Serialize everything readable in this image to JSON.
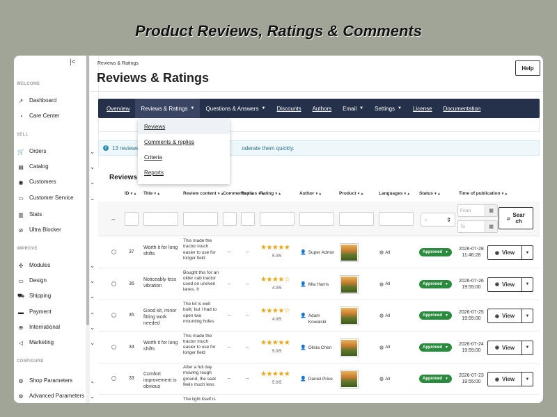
{
  "banner": "Product Reviews, Ratings & Comments",
  "sidebar": {
    "collapse_icon": "collapse-icon",
    "sections": {
      "welcome": "WELCOME",
      "sell": "SELL",
      "improve": "IMPROVE",
      "configure": "CONFIGURE"
    },
    "items": [
      {
        "label": "Dashboard",
        "icon": "trend-icon",
        "chevron": false
      },
      {
        "label": "Care Center",
        "icon": "care-icon",
        "chevron": false
      },
      {
        "label": "Orders",
        "icon": "basket-icon",
        "chevron": true
      },
      {
        "label": "Catalog",
        "icon": "catalog-icon",
        "chevron": true
      },
      {
        "label": "Customers",
        "icon": "customer-icon",
        "chevron": true
      },
      {
        "label": "Customer Service",
        "icon": "chat-icon",
        "chevron": true
      },
      {
        "label": "Stats",
        "icon": "stats-icon",
        "chevron": false
      },
      {
        "label": "Ultra Blocker",
        "icon": "blocker-icon",
        "chevron": false
      },
      {
        "label": "Modules",
        "icon": "puzzle-icon",
        "chevron": true
      },
      {
        "label": "Design",
        "icon": "monitor-icon",
        "chevron": true
      },
      {
        "label": "Shipping",
        "icon": "truck-icon",
        "chevron": true
      },
      {
        "label": "Payment",
        "icon": "card-icon",
        "chevron": true
      },
      {
        "label": "International",
        "icon": "globe-icon",
        "chevron": true
      },
      {
        "label": "Marketing",
        "icon": "megaphone-icon",
        "chevron": true
      },
      {
        "label": "Shop Parameters",
        "icon": "gear-icon",
        "chevron": true
      },
      {
        "label": "Advanced Parameters",
        "icon": "advanced-icon",
        "chevron": true
      }
    ]
  },
  "header": {
    "breadcrumb": "Reviews & Ratings",
    "title": "Reviews & Ratings",
    "help_label": "Help"
  },
  "nav": {
    "items": [
      {
        "label": "Overview",
        "dropdown": false
      },
      {
        "label": "Reviews & Ratings",
        "dropdown": true
      },
      {
        "label": "Questions & Answers",
        "dropdown": true
      },
      {
        "label": "Discounts",
        "dropdown": false
      },
      {
        "label": "Authors",
        "dropdown": false
      },
      {
        "label": "Email",
        "dropdown": true
      },
      {
        "label": "Settings",
        "dropdown": true
      },
      {
        "label": "License",
        "dropdown": false
      },
      {
        "label": "Documentation",
        "dropdown": false
      }
    ],
    "dropdown_items": [
      "Reviews",
      "Comments & replies",
      "Criteria",
      "Reports"
    ]
  },
  "info": {
    "text": "13 reviews",
    "text_tail": "oderate them quickly."
  },
  "panel": {
    "title": "Reviews",
    "columns": [
      "ID",
      "Title",
      "Review content",
      "Comments",
      "Replies",
      "Rating",
      "Author",
      "Product",
      "Languages",
      "Status",
      "Time of publication"
    ],
    "filters": {
      "dash": "--",
      "status_value": "-",
      "date_from_placeholder": "From",
      "date_to_placeholder": "To",
      "search_label": "Sear ch"
    },
    "rows": [
      {
        "id": "37",
        "title": "Worth it for long shifts",
        "content": "This made the tractor much easier to use for longer field",
        "comments": "--",
        "replies": "--",
        "stars": "★★★★★",
        "rating": "5.0/5",
        "rating_value": 5.0,
        "author": "Super Admin",
        "language": "All",
        "status": "Approved",
        "date": "2026-07-28",
        "time": "11:46:28",
        "view_label": "View"
      },
      {
        "id": "36",
        "title": "Noticeably less vibration",
        "content": "Bought this for an older cab tractor used on uneven lanes. It",
        "comments": "--",
        "replies": "--",
        "stars": "★★★★☆",
        "rating": "4.0/5",
        "rating_value": 4.0,
        "author": "Mia Harris",
        "language": "All",
        "status": "Approved",
        "date": "2026-07-26",
        "time": "19:55:00",
        "view_label": "View"
      },
      {
        "id": "35",
        "title": "Good kit, minor fitting work needed",
        "content": "The kit is well built, but I had to open two mounting holes",
        "comments": "--",
        "replies": "--",
        "stars": "★★★★☆",
        "rating": "4.0/5",
        "rating_value": 4.0,
        "author": "Adam Kowalski",
        "language": "All",
        "status": "Approved",
        "date": "2026-07-25",
        "time": "19:55:00",
        "view_label": "View"
      },
      {
        "id": "34",
        "title": "Worth it for long shifts",
        "content": "This made the tractor much easier to use for longer field",
        "comments": "--",
        "replies": "--",
        "stars": "★★★★★",
        "rating": "5.0/5",
        "rating_value": 5.0,
        "author": "Olivia Chen",
        "language": "All",
        "status": "Approved",
        "date": "2026-07-24",
        "time": "19:55:00",
        "view_label": "View"
      },
      {
        "id": "33",
        "title": "Comfort improvement is obvious",
        "content": "After a full day mowing rough ground, the seat feels much less",
        "comments": "--",
        "replies": "--",
        "stars": "★★★★★",
        "rating": "5.0/5",
        "rating_value": 5.0,
        "author": "Daniel Price",
        "language": "All",
        "status": "Approved",
        "date": "2026-07-23",
        "time": "19:55:00",
        "view_label": "View"
      },
      {
        "id": "",
        "title": "",
        "content": "The light itself is",
        "comments": "",
        "replies": "",
        "stars": "",
        "rating": "",
        "rating_value": null,
        "author": "",
        "language": "",
        "status": "",
        "date": "",
        "time": "",
        "view_label": ""
      }
    ]
  },
  "colors": {
    "navbar": "#25304a",
    "approved": "#2a8a3e",
    "star": "#e9a716",
    "info_bg": "#eef8fb"
  }
}
